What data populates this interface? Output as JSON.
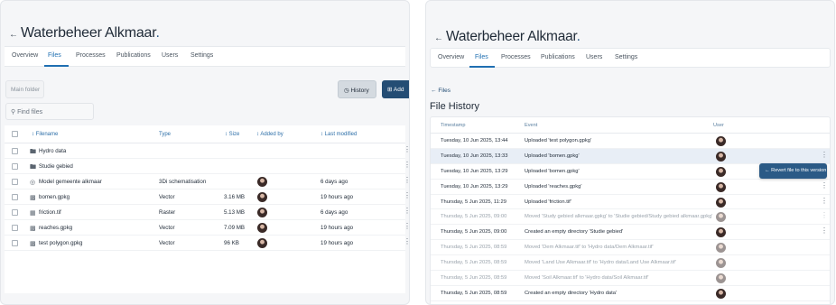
{
  "left": {
    "title": "Waterbeheer Alkmaar",
    "back_icon": "arrow-left-icon",
    "tabs": [
      {
        "label": "Overview",
        "active": false
      },
      {
        "label": "Files",
        "active": true
      },
      {
        "label": "Processes",
        "active": false
      },
      {
        "label": "Publications",
        "active": false
      },
      {
        "label": "Users",
        "active": false
      },
      {
        "label": "Settings",
        "active": false
      }
    ],
    "main_folder_label": "Main folder",
    "history_label": "History",
    "add_label": "Add",
    "search_placeholder": "Find files",
    "columns": [
      "Filename",
      "Type",
      "Size",
      "Added by",
      "Last modified"
    ],
    "rows": [
      {
        "icon": "folder-icon",
        "name": "Hydro data",
        "type": "",
        "size": "",
        "avatar": false,
        "modified": ""
      },
      {
        "icon": "folder-icon",
        "name": "Studie gebied",
        "type": "",
        "size": "",
        "avatar": false,
        "modified": ""
      },
      {
        "icon": "model-icon",
        "name": "Model gemeente alkmaar",
        "type": "3Di schematisation",
        "size": "",
        "avatar": true,
        "modified": "6 days ago"
      },
      {
        "icon": "vector-icon",
        "name": "bomen.gpkg",
        "type": "Vector",
        "size": "3.16 MB",
        "avatar": true,
        "modified": "19 hours ago"
      },
      {
        "icon": "raster-icon",
        "name": "friction.tif",
        "type": "Raster",
        "size": "5.13 MB",
        "avatar": true,
        "modified": "6 days ago"
      },
      {
        "icon": "vector-icon",
        "name": "reaches.gpkg",
        "type": "Vector",
        "size": "7.09 MB",
        "avatar": true,
        "modified": "19 hours ago"
      },
      {
        "icon": "vector-icon",
        "name": "test polygon.gpkg",
        "type": "Vector",
        "size": "96 KB",
        "avatar": true,
        "modified": "19 hours ago"
      }
    ]
  },
  "right": {
    "title": "Waterbeheer Alkmaar",
    "tabs": [
      {
        "label": "Overview",
        "active": false
      },
      {
        "label": "Files",
        "active": true
      },
      {
        "label": "Processes",
        "active": false
      },
      {
        "label": "Publications",
        "active": false
      },
      {
        "label": "Users",
        "active": false
      },
      {
        "label": "Settings",
        "active": false
      }
    ],
    "files_link": "Files",
    "page_title": "File History",
    "columns": [
      "Timestamp",
      "Event",
      "User"
    ],
    "revert_label": "Revert file to this version",
    "rows": [
      {
        "ts": "Tuesday, 10 Jun 2025, 13:44",
        "event": "Uploaded 'test polygon.gpkg'",
        "faded": false,
        "selected": false,
        "kebab": false
      },
      {
        "ts": "Tuesday, 10 Jun 2025, 13:33",
        "event": "Uploaded 'bomen.gpkg'",
        "faded": false,
        "selected": true,
        "kebab": true
      },
      {
        "ts": "Tuesday, 10 Jun 2025, 13:29",
        "event": "Uploaded 'bomen.gpkg'",
        "faded": false,
        "selected": false,
        "kebab": false
      },
      {
        "ts": "Tuesday, 10 Jun 2025, 13:29",
        "event": "Uploaded 'reaches.gpkg'",
        "faded": false,
        "selected": false,
        "kebab": true
      },
      {
        "ts": "Thursday, 5 Jun 2025, 11:29",
        "event": "Uploaded 'friction.tif'",
        "faded": false,
        "selected": false,
        "kebab": true
      },
      {
        "ts": "Thursday, 5 Jun 2025, 09:00",
        "event": "Moved 'Study gebied alkmaar.gpkg' to 'Studie gebied/Study gebied alkmaar.gpkg'",
        "faded": true,
        "selected": false,
        "kebab": true
      },
      {
        "ts": "Thursday, 5 Jun 2025, 09:00",
        "event": "Created an empty directory 'Studie gebied'",
        "faded": false,
        "selected": false,
        "kebab": true
      },
      {
        "ts": "Thursday, 5 Jun 2025, 08:59",
        "event": "Moved 'Dem Alkmaar.tif' to 'Hydro data/Dem Alkmaar.tif'",
        "faded": true,
        "selected": false,
        "kebab": false
      },
      {
        "ts": "Thursday, 5 Jun 2025, 08:59",
        "event": "Moved 'Land Use Alkmaar.tif' to 'Hydro data/Land Use Alkmaar.tif'",
        "faded": true,
        "selected": false,
        "kebab": false
      },
      {
        "ts": "Thursday, 5 Jun 2025, 08:59",
        "event": "Moved 'Soil Alkmaar.tif' to 'Hydro data/Soil Alkmaar.tif'",
        "faded": true,
        "selected": false,
        "kebab": false
      },
      {
        "ts": "Thursday, 5 Jun 2025, 08:59",
        "event": "Created an empty directory 'Hydro data'",
        "faded": false,
        "selected": false,
        "kebab": false
      }
    ]
  },
  "colors": {
    "accent": "#1f6fb2",
    "primary_button": "#244d74",
    "selected_row": "#e8eef6"
  }
}
